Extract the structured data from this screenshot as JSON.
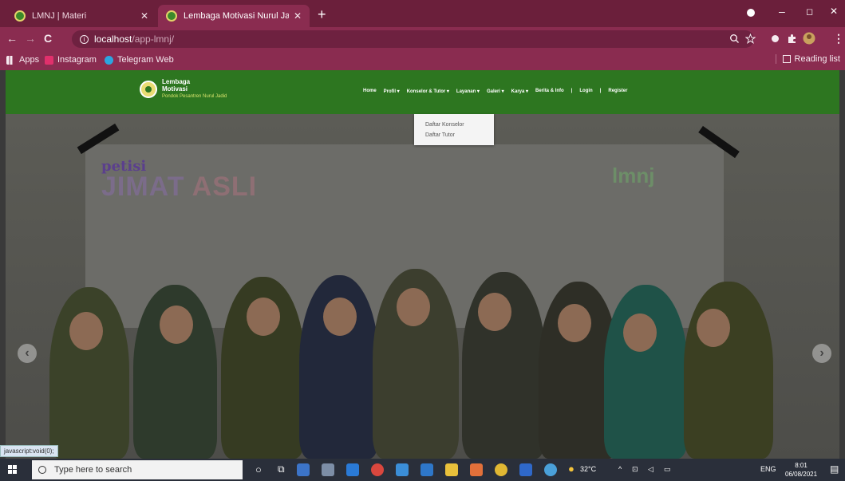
{
  "tabs": [
    {
      "title": "LMNJ | Materi"
    },
    {
      "title": "Lembaga Motivasi Nurul Jadid -"
    }
  ],
  "window_controls": {
    "minimize": "–",
    "maximize": "◻",
    "close": "✕"
  },
  "tab_close": "✕",
  "new_tab": "+",
  "address": {
    "host": "localhost",
    "path": "/app-lmnj/"
  },
  "bookmarks": [
    {
      "label": "Apps"
    },
    {
      "label": "Instagram"
    },
    {
      "label": "Telegram Web"
    }
  ],
  "reading_list": "Reading list",
  "site": {
    "brand_line1": "Lembaga",
    "brand_line2": "Motivasi",
    "brand_sub": "Pondok Pesantren Nurul Jadid",
    "menu": [
      "Home",
      "Profil ▾",
      "Konselor & Tutor ▾",
      "Layanan ▾",
      "Galeri ▾",
      "Karya ▾",
      "Berita & Info",
      "|",
      "Login",
      "|",
      "Register"
    ],
    "dropdown": [
      "Daftar Konselor",
      "Daftar Tutor"
    ]
  },
  "hero": {
    "banner_small": "petisi",
    "banner_big_1": "JIMAT",
    "banner_big_2": " ASLI",
    "watermark": "lmnj",
    "prev": "‹",
    "next": "›"
  },
  "status_url": "javascript:void(0);",
  "taskbar": {
    "search_placeholder": "Type here to search",
    "weather": "32°C",
    "lang": "ENG",
    "time": "8:01",
    "date": "06/08/2021"
  },
  "colors": {
    "chrome": "#8a2c50",
    "site_nav": "#2d7620"
  }
}
